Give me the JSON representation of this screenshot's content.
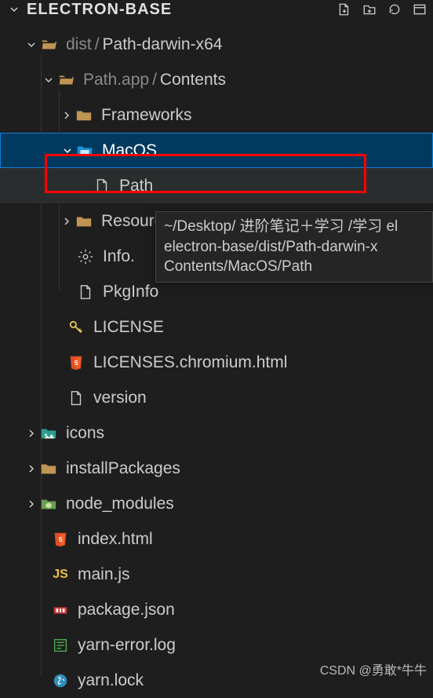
{
  "header": {
    "title": "ELECTRON-BASE",
    "action_newfile": "new-file",
    "action_newfolder": "new-folder",
    "action_refresh": "refresh",
    "action_collapse": "collapse"
  },
  "tree": {
    "dist": {
      "label": "dist",
      "sub": "Path-darwin-x64"
    },
    "pathapp": {
      "label": "Path.app",
      "sub": "Contents"
    },
    "frameworks": "Frameworks",
    "macos": "MacOS",
    "path": "Path",
    "resources": "Resources",
    "infoplist": "Info.",
    "pkginfo": "PkgInfo",
    "license": "LICENSE",
    "licenses_chromium": "LICENSES.chromium.html",
    "version": "version",
    "icons": "icons",
    "installpackages": "installPackages",
    "node_modules": "node_modules",
    "indexhtml": "index.html",
    "mainjs": "main.js",
    "packagejson": "package.json",
    "yarnerror": "yarn-error.log",
    "yarnlock": "yarn.lock"
  },
  "tooltip": {
    "line1": "~/Desktop/ 进阶笔记＋学习 /学习 el",
    "line2": "electron-base/dist/Path-darwin-x",
    "line3": "Contents/MacOS/Path"
  },
  "watermark": "CSDN @勇敢*牛牛"
}
